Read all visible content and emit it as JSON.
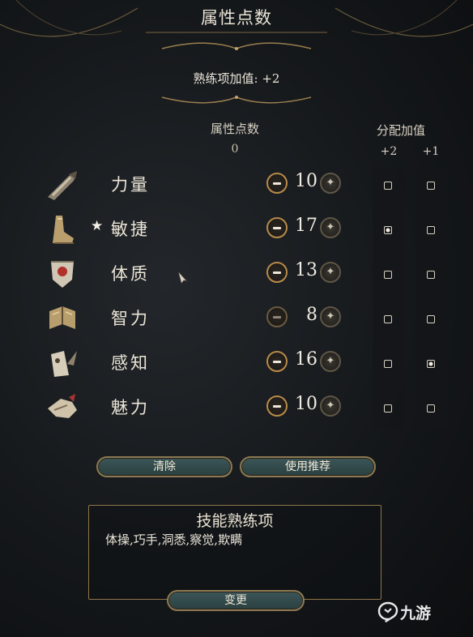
{
  "header": {
    "title": "属性点数",
    "proficiency_bonus": "熟练项加值: +2"
  },
  "columns": {
    "points_label": "属性点数",
    "points_remaining": "0",
    "bonus_label": "分配加值",
    "bonus_plus2": "+2",
    "bonus_plus1": "+1"
  },
  "attributes": [
    {
      "name": "力量",
      "value": "10",
      "icon": "strength-arm-icon",
      "favored": false,
      "plus2": false,
      "plus1": false,
      "minus_enabled": true
    },
    {
      "name": "敏捷",
      "value": "17",
      "icon": "dexterity-boot-icon",
      "favored": true,
      "plus2": true,
      "plus1": false,
      "minus_enabled": true
    },
    {
      "name": "体质",
      "value": "13",
      "icon": "constitution-heart-icon",
      "favored": false,
      "plus2": false,
      "plus1": false,
      "minus_enabled": true
    },
    {
      "name": "智力",
      "value": "8",
      "icon": "intelligence-book-icon",
      "favored": false,
      "plus2": false,
      "plus1": false,
      "minus_enabled": false
    },
    {
      "name": "感知",
      "value": "16",
      "icon": "wisdom-owl-icon",
      "favored": false,
      "plus2": false,
      "plus1": true,
      "minus_enabled": true
    },
    {
      "name": "魅力",
      "value": "10",
      "icon": "charisma-hand-icon",
      "favored": false,
      "plus2": false,
      "plus1": false,
      "minus_enabled": true
    }
  ],
  "buttons": {
    "reset": "清除",
    "use_recommended": "使用推荐",
    "change": "变更"
  },
  "skills": {
    "title": "技能熟练项",
    "list": "体操,巧手,洞悉,察觉,欺瞒"
  },
  "watermark": {
    "text": "九游",
    "logo_icon": "jiuyou-logo-icon"
  },
  "colors": {
    "accent_gold": "#b88a4a",
    "button_teal": "#3c5657"
  }
}
